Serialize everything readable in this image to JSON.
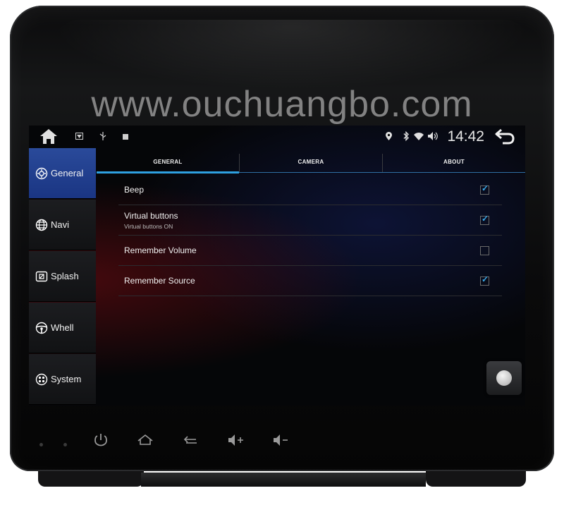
{
  "watermark": "www.ouchuangbo.com",
  "statusbar": {
    "time": "14:42",
    "left_icons": [
      "home-icon",
      "screenshot-icon",
      "usb-icon",
      "notification-icon"
    ],
    "right_icons": [
      "location-icon",
      "bluetooth-icon",
      "wifi-icon",
      "volume-icon"
    ]
  },
  "sidebar": {
    "items": [
      {
        "label": "General",
        "icon": "gear-icon",
        "active": true
      },
      {
        "label": "Navi",
        "icon": "globe-icon",
        "active": false
      },
      {
        "label": "Splash",
        "icon": "image-icon",
        "active": false
      },
      {
        "label": "Whell",
        "icon": "steering-wheel-icon",
        "active": false
      },
      {
        "label": "System",
        "icon": "system-icon",
        "active": false
      }
    ]
  },
  "tabs": [
    {
      "label": "GENERAL",
      "active": true
    },
    {
      "label": "CAMERA",
      "active": false
    },
    {
      "label": "ABOUT",
      "active": false
    }
  ],
  "settings": [
    {
      "title": "Beep",
      "subtitle": "",
      "checked": true
    },
    {
      "title": "Virtual buttons",
      "subtitle": "Virtual buttons ON",
      "checked": true
    },
    {
      "title": "Remember Volume",
      "subtitle": "",
      "checked": false
    },
    {
      "title": "Remember Source",
      "subtitle": "",
      "checked": true
    }
  ],
  "hardware_buttons": [
    "power-icon",
    "home-icon",
    "back-icon",
    "volume-up-icon",
    "volume-down-icon"
  ],
  "colors": {
    "accent": "#2ea0e0",
    "sidebar_active": "#1f3e8c",
    "check": "#39a9e8"
  }
}
